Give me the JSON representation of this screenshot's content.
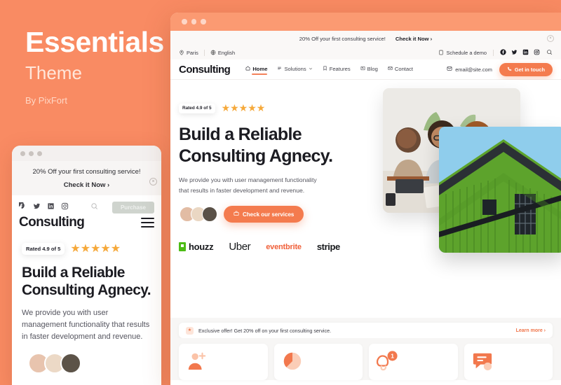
{
  "promo": {
    "title": "Essentials",
    "subtitle": "Theme",
    "byline": "By PixFort"
  },
  "colors": {
    "background": "#f98b63",
    "accent": "#f47b4e",
    "star": "#f6a93b",
    "heading": "#1c1c22",
    "houzz_green": "#4dbc15",
    "eventbrite_orange": "#f0603a"
  },
  "mobile": {
    "notice": {
      "text": "20% Off your first consulting service!",
      "cta": "Check it Now ›",
      "close": "×"
    },
    "social_icons": [
      "facebook-icon",
      "twitter-icon",
      "linkedin-icon",
      "instagram-icon"
    ],
    "search_icon": "search-icon",
    "purchase_label": "Purchase",
    "brand": "Consulting",
    "menu_icon": "hamburger-icon",
    "hero": {
      "rated_label": "Rated 4.9 of 5",
      "stars": 5,
      "heading_line1": "Build a Reliable",
      "heading_line2": "Consulting Agnecy.",
      "paragraph": "We provide you with user management functionality that results in faster development and revenue."
    }
  },
  "desktop": {
    "window_dots": 3,
    "notice": {
      "text": "20% Off your first consulting service!",
      "cta": "Check it Now ›",
      "close": "×"
    },
    "topbar": {
      "location": "Paris",
      "language": "English",
      "schedule": "Schedule a demo",
      "social_icons": [
        "facebook-icon",
        "twitter-icon",
        "linkedin-icon",
        "instagram-icon"
      ],
      "search_icon": "search-icon"
    },
    "nav": {
      "brand": "Consulting",
      "items": [
        {
          "label": "Home",
          "icon": "home-icon",
          "active": true,
          "caret": false
        },
        {
          "label": "Solutions",
          "icon": "list-icon",
          "active": false,
          "caret": true
        },
        {
          "label": "Features",
          "icon": "bookmark-icon",
          "active": false,
          "caret": false
        },
        {
          "label": "Blog",
          "icon": "article-icon",
          "active": false,
          "caret": false
        },
        {
          "label": "Contact",
          "icon": "envelope-icon",
          "active": false,
          "caret": false
        }
      ],
      "email": "email@site.com",
      "cta": "Get in touch"
    },
    "hero": {
      "rated_label": "Rated 4.9 of 5",
      "stars": 5,
      "heading_line1": "Build a Reliable",
      "heading_line2": "Consulting Agnecy.",
      "paragraph_line1": "We provide you with user management functionality",
      "paragraph_line2": "that results in faster development and revenue.",
      "button": "Check our services",
      "brands": [
        {
          "name": "houzz",
          "label": "houzz"
        },
        {
          "name": "uber",
          "label": "Uber"
        },
        {
          "name": "eventbrite",
          "label": "eventbrite"
        },
        {
          "name": "stripe",
          "label": "stripe"
        }
      ]
    },
    "offer": {
      "icon": "megaphone-icon",
      "text": "Exclusive offer! Get 20% off on your first consulting service.",
      "learn_more": "Learn more  ›"
    },
    "cards": [
      {
        "icon": "add-user-icon",
        "badge": ""
      },
      {
        "icon": "pie-chart-icon",
        "badge": ""
      },
      {
        "icon": "notification-bell-icon",
        "badge": "1"
      },
      {
        "icon": "chat-message-icon",
        "badge": ""
      }
    ]
  }
}
